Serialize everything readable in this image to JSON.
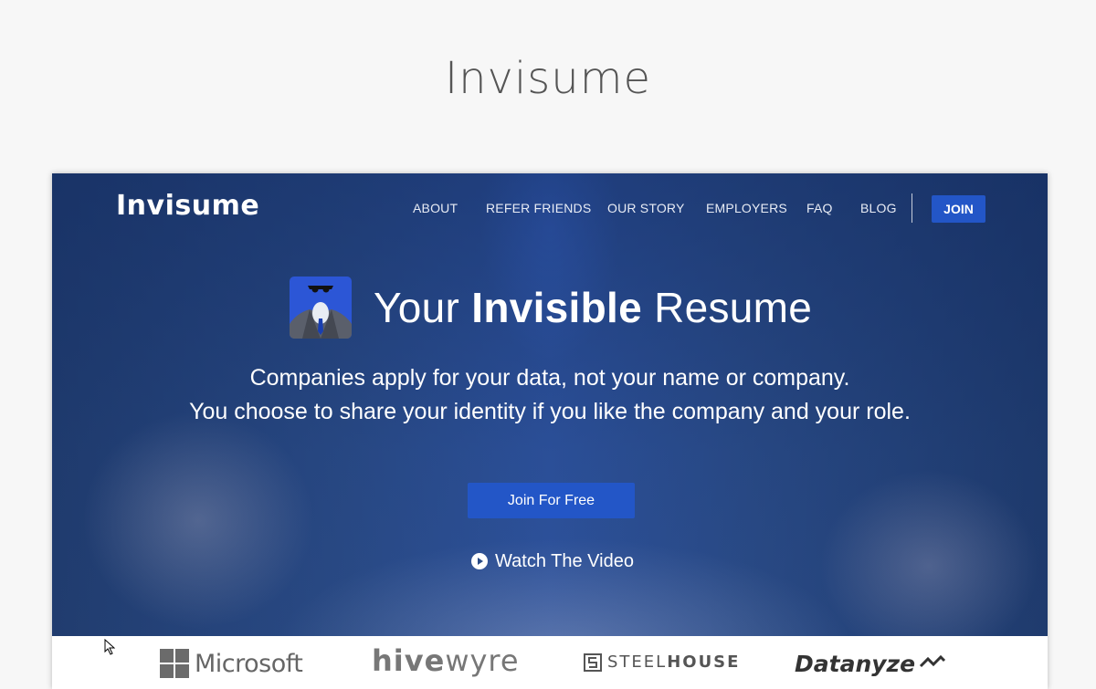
{
  "page_heading": "Invisume",
  "site": {
    "brand": "Invisume",
    "nav": {
      "items": [
        "ABOUT",
        "REFER FRIENDS",
        "OUR STORY",
        "EMPLOYERS",
        "FAQ",
        "BLOG"
      ],
      "join_label": "JOIN"
    },
    "hero": {
      "headline_prefix": "Your ",
      "headline_bold": "Invisible",
      "headline_suffix": " Resume",
      "sub_line_1": "Companies apply for your data, not your name or company.",
      "sub_line_2": "You choose to share your identity if you like the company and your role.",
      "cta_label": "Join For Free",
      "video_label": "Watch The Video"
    },
    "logos": {
      "microsoft": "Microsoft",
      "hivewyre_bold": "hive",
      "hivewyre_rest": "wyre",
      "steelhouse_light": "STEEL",
      "steelhouse_bold": "HOUSE",
      "datanyze": "Datanyze"
    }
  },
  "colors": {
    "accent": "#2356c7",
    "hero_bg": "#2a4b86",
    "heading_text": "#555555"
  },
  "icons": {
    "app_icon": "invisible-man-icon",
    "play": "play-circle-icon",
    "cursor": "mouse-pointer-icon"
  }
}
